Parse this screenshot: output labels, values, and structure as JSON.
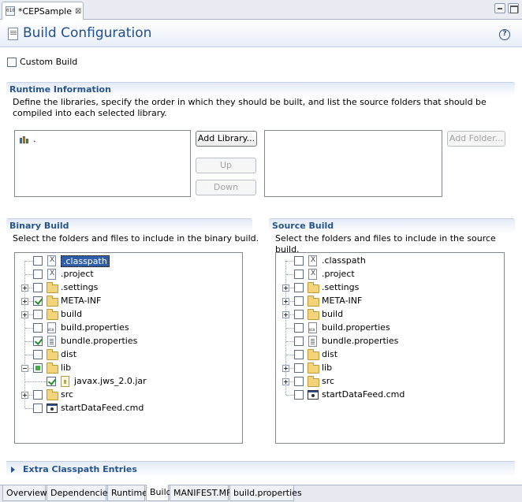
{
  "editor_tab": {
    "title": "*CEPSample",
    "close": "⊠"
  },
  "header": {
    "title": "Build Configuration",
    "help": "?"
  },
  "custom_build": {
    "label": "Custom Build",
    "checked": false
  },
  "runtime": {
    "title": "Runtime Information",
    "description": "Define the libraries, specify the order in which they should be built, and list the source folders that should be compiled into each selected library.",
    "libraries": [
      "."
    ],
    "buttons": {
      "add_library": "Add Library...",
      "up": "Up",
      "down": "Down",
      "add_folder": "Add Folder..."
    }
  },
  "binary_build": {
    "title": "Binary Build",
    "description": "Select the folders and files to include in the binary build.",
    "items": [
      {
        "name": ".classpath",
        "icon": "xml-file-icon",
        "checked": false,
        "expandable": false,
        "selected": true
      },
      {
        "name": ".project",
        "icon": "xml-file-icon",
        "checked": false,
        "expandable": false
      },
      {
        "name": ".settings",
        "icon": "folder-icon",
        "checked": false,
        "expandable": true
      },
      {
        "name": "META-INF",
        "icon": "folder-icon",
        "checked": true,
        "expandable": true
      },
      {
        "name": "build",
        "icon": "folder-icon",
        "checked": false,
        "expandable": true
      },
      {
        "name": "build.properties",
        "icon": "properties-file-icon",
        "checked": false,
        "expandable": false
      },
      {
        "name": "bundle.properties",
        "icon": "text-file-icon",
        "checked": true,
        "expandable": false
      },
      {
        "name": "dist",
        "icon": "folder-icon",
        "checked": false,
        "expandable": false
      },
      {
        "name": "lib",
        "icon": "folder-icon",
        "checked": "partial",
        "expandable": true,
        "expanded": true
      },
      {
        "name": "javax.jws_2.0.jar",
        "icon": "jar-file-icon",
        "checked": true,
        "expandable": false,
        "child": true
      },
      {
        "name": "src",
        "icon": "folder-icon",
        "checked": false,
        "expandable": true
      },
      {
        "name": "startDataFeed.cmd",
        "icon": "cmd-file-icon",
        "checked": false,
        "expandable": false
      }
    ]
  },
  "source_build": {
    "title": "Source Build",
    "description": "Select the folders and files to include in the source build.",
    "items": [
      {
        "name": ".classpath",
        "icon": "xml-file-icon",
        "checked": false,
        "expandable": false
      },
      {
        "name": ".project",
        "icon": "xml-file-icon",
        "checked": false,
        "expandable": false
      },
      {
        "name": ".settings",
        "icon": "folder-icon",
        "checked": false,
        "expandable": true
      },
      {
        "name": "META-INF",
        "icon": "folder-icon",
        "checked": false,
        "expandable": true
      },
      {
        "name": "build",
        "icon": "folder-icon",
        "checked": false,
        "expandable": true
      },
      {
        "name": "build.properties",
        "icon": "properties-file-icon",
        "checked": false,
        "expandable": false
      },
      {
        "name": "bundle.properties",
        "icon": "text-file-icon",
        "checked": false,
        "expandable": false
      },
      {
        "name": "dist",
        "icon": "folder-icon",
        "checked": false,
        "expandable": false
      },
      {
        "name": "lib",
        "icon": "folder-icon",
        "checked": false,
        "expandable": true
      },
      {
        "name": "src",
        "icon": "folder-icon",
        "checked": false,
        "expandable": true
      },
      {
        "name": "startDataFeed.cmd",
        "icon": "cmd-file-icon",
        "checked": false,
        "expandable": false
      }
    ]
  },
  "extra_classpath": {
    "title": "Extra Classpath Entries"
  },
  "bottom_tabs": [
    {
      "label": "Overview",
      "active": false
    },
    {
      "label": "Dependencies",
      "active": false
    },
    {
      "label": "Runtime",
      "active": false
    },
    {
      "label": "Build",
      "active": true
    },
    {
      "label": "MANIFEST.MF",
      "active": false
    },
    {
      "label": "build.properties",
      "active": false
    }
  ],
  "colors": {
    "section_title": "#26558e",
    "header_title": "#1f4f8f",
    "selection": "#2f5fa8",
    "check": "#1f8f1f"
  }
}
